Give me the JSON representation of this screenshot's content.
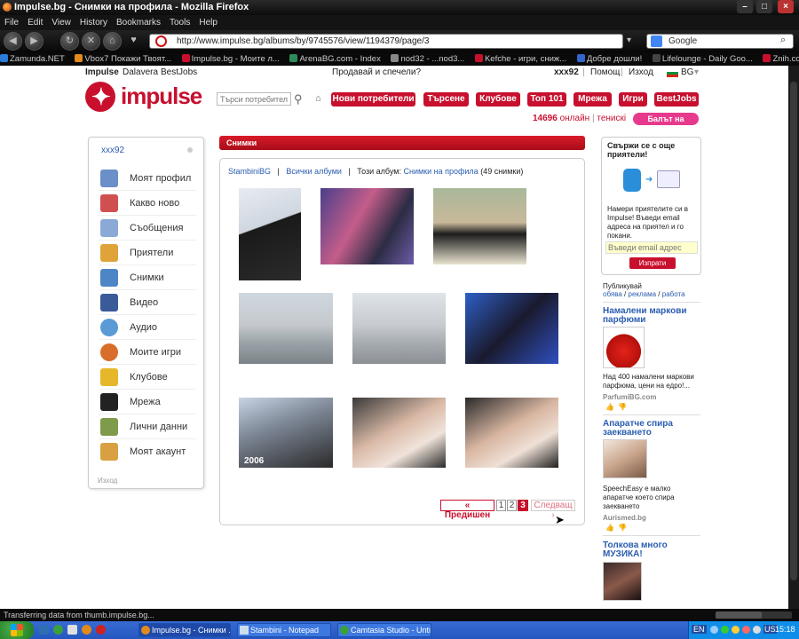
{
  "window": {
    "title": "Impulse.bg - Снимки на профила - Mozilla Firefox"
  },
  "menu": [
    "File",
    "Edit",
    "View",
    "History",
    "Bookmarks",
    "Tools",
    "Help"
  ],
  "nav": {
    "url": "http://www.impulse.bg/albums/by/9745576/view/1194379/page/3",
    "search_placeholder": "Google"
  },
  "bookmarks": [
    {
      "label": "Zamunda.NET",
      "color": "#2b7bd8"
    },
    {
      "label": "Vbox7 Покажи Твоят...",
      "color": "#e08a1c"
    },
    {
      "label": "Impulse.bg - Моите л...",
      "color": "#c8102e"
    },
    {
      "label": "ArenaBG.com - Index",
      "color": "#2e8b57"
    },
    {
      "label": "nod32 -  ...nod3...",
      "color": "#888888"
    },
    {
      "label": "Kefche - игри, сниж...",
      "color": "#c8102e"
    },
    {
      "label": "Добре дошли!",
      "color": "#3366cc"
    },
    {
      "label": "Lifelounge - Daily Goo...",
      "color": "#444444"
    },
    {
      "label": "Znih.com - Направи с...",
      "color": "#c8102e"
    }
  ],
  "site_top": {
    "impulse": "Impulse",
    "dalavera": "Dalavera",
    "bestjobs": "BestJobs",
    "promo": "Продавай и спечели?",
    "user": "xxx92",
    "help": "Помощ",
    "logout": "Изход",
    "lang": "BG"
  },
  "logo": "impulse",
  "header": {
    "search_placeholder": "Търси потребители",
    "buttons": [
      "Нови потребители",
      "Търсене",
      "Клубове",
      "Топ 101",
      "Мрежа",
      "Игри",
      "BestJobs"
    ],
    "online_count": "14696",
    "online_label": "онлайн",
    "online_sep": "|",
    "tennis": "тенискi",
    "ball_button": "Балът на Impulse"
  },
  "sidebar": {
    "user": "xxx92",
    "items": [
      {
        "label": "Моят профил",
        "icon": "profile-icon",
        "color": "#6a8fc9"
      },
      {
        "label": "Какво ново",
        "icon": "news-icon",
        "color": "#d05050"
      },
      {
        "label": "Съобщения",
        "icon": "mail-icon",
        "color": "#8aa9d6"
      },
      {
        "label": "Приятели",
        "icon": "friends-icon",
        "color": "#e0a33a"
      },
      {
        "label": "Снимки",
        "icon": "photos-icon",
        "color": "#4c86c6"
      },
      {
        "label": "Видео",
        "icon": "video-icon",
        "color": "#3a5b9a"
      },
      {
        "label": "Аудио",
        "icon": "audio-icon",
        "color": "#5a9bd5"
      },
      {
        "label": "Моите игри",
        "icon": "games-icon",
        "color": "#d96d2b"
      },
      {
        "label": "Клубове",
        "icon": "clubs-icon",
        "color": "#e6b72a"
      },
      {
        "label": "Мрежа",
        "icon": "network-icon",
        "color": "#222222"
      },
      {
        "label": "Лични данни",
        "icon": "personal-data-icon",
        "color": "#7d9b4a"
      },
      {
        "label": "Моят акаунт",
        "icon": "account-icon",
        "color": "#d8a040"
      }
    ],
    "logout": "Изход"
  },
  "main": {
    "section_title": "Снимки",
    "crumb_owner": "StambiniBG",
    "crumb_sep": "|",
    "crumb_all": "Всички албуми",
    "crumb_this": "Този албум:",
    "crumb_album": "Снимки на профила",
    "crumb_count": "(49 снимки)",
    "photos": [
      {
        "bg": "linear-gradient(160deg,#e8ecf2 0%,#cfd6df 40%,#1a1a1a 41%,#2b2b2b 100%)",
        "caption": ""
      },
      {
        "bg": "linear-gradient(120deg,#4a3f8a 0%,#c45d8a 40%,#2c2c44 70%,#6e5ca8 100%)",
        "caption": ""
      },
      {
        "bg": "linear-gradient(180deg,#a9b89a 0%,#c8b99a 45%,#1c1c1c 60%,#e9e2cf 100%)",
        "caption": ""
      },
      {
        "bg": "linear-gradient(180deg,#cfd8df 0%,#c5c9cd 45%,#9aa3a8 70%,#7c8388 100%)",
        "caption": ""
      },
      {
        "bg": "linear-gradient(180deg,#dfe4e8 0%,#c7cbcf 45%,#a8adb2 70%,#8b9095 100%)",
        "caption": ""
      },
      {
        "bg": "linear-gradient(135deg,#2e5fc7 0%,#1a1a2e 50%,#2f4fbf 100%)",
        "caption": ""
      },
      {
        "bg": "linear-gradient(160deg,#c8d4e4 0%,#7d8796 40%,#2a2a2a 100%)",
        "caption": "2006"
      },
      {
        "bg": "linear-gradient(150deg,#3a3a3a 0%,#d9b9a6 45%,#f0e3da 70%,#2a2a2a 100%)",
        "caption": ""
      },
      {
        "bg": "linear-gradient(150deg,#2a2a2a 0%,#d8b6a1 45%,#efe0d6 70%,#1f1f1f 100%)",
        "caption": ""
      }
    ]
  },
  "pager": {
    "prev": "« Предишен",
    "pages": [
      "1",
      "2",
      "3"
    ],
    "current": "3",
    "next": "Следващ ›"
  },
  "right": {
    "connect_title": "Свържи се с още приятели!",
    "connect_text": "Намери приятелите си в Impulse! Въведи email адреса на приятел и го покани.",
    "email_placeholder": "Въведи email адрес",
    "send": "Изпрати",
    "publish": "Публикувай",
    "publish_links": [
      "обява",
      "реклама",
      "работа"
    ],
    "ads": [
      {
        "title": "Намалени маркови парфюми",
        "text": "Над 400 намалени маркови парфюма, цени на едро!...",
        "source": "ParfumiBG.com"
      },
      {
        "title": "Апаратче спира заекването",
        "text": "SpeechEasy е малко апаратче което спира заекването",
        "source": "Aurismed.bg"
      },
      {
        "title": "Толкова много МУЗИКА!",
        "text": "",
        "source": ""
      }
    ]
  },
  "status": "Transferring data from thumb.impulse.bg...",
  "taskbar": {
    "tasks": [
      "Impulse.bg - Снимки ...",
      "Stambini - Notepad",
      "Camtasia Studio - Unti..."
    ],
    "lang": "EN",
    "lang2": "US",
    "time": "15:18"
  }
}
